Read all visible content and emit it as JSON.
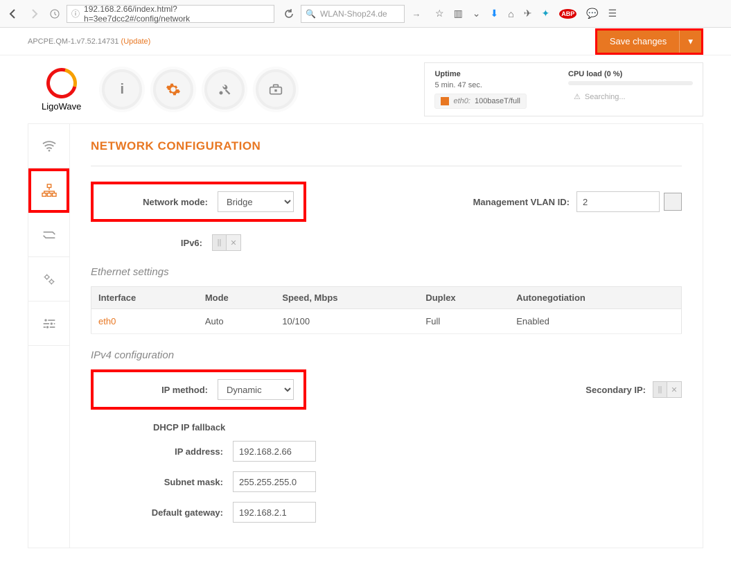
{
  "browser": {
    "url": "192.168.2.66/index.html?h=3ee7dcc2#/config/network",
    "search_placeholder": "WLAN-Shop24.de"
  },
  "topbar": {
    "fw": "APCPE.QM-1.v7.52.14731",
    "update_label": "(Update)",
    "save_label": "Save changes"
  },
  "logo_text": "LigoWave",
  "status": {
    "uptime_label": "Uptime",
    "uptime_value": "5 min. 47 sec.",
    "cpu_label": "CPU load (0 %)",
    "eth_iface": "eth0:",
    "eth_speed": "100baseT/full",
    "wifi_status": "Searching..."
  },
  "page_title": "NETWORK CONFIGURATION",
  "network_mode": {
    "label": "Network mode:",
    "value": "Bridge"
  },
  "vlan": {
    "label": "Management VLAN ID:",
    "value": "2"
  },
  "ipv6": {
    "label": "IPv6:"
  },
  "ethernet": {
    "section": "Ethernet settings",
    "headers": [
      "Interface",
      "Mode",
      "Speed, Mbps",
      "Duplex",
      "Autonegotiation"
    ],
    "row": {
      "iface": "eth0",
      "mode": "Auto",
      "speed": "10/100",
      "duplex": "Full",
      "auto": "Enabled"
    }
  },
  "ipv4": {
    "section": "IPv4 configuration",
    "method_label": "IP method:",
    "method_value": "Dynamic",
    "secondary_label": "Secondary IP:",
    "fallback_header": "DHCP IP fallback",
    "ip_label": "IP address:",
    "ip_value": "192.168.2.66",
    "mask_label": "Subnet mask:",
    "mask_value": "255.255.255.0",
    "gw_label": "Default gateway:",
    "gw_value": "192.168.2.1"
  }
}
